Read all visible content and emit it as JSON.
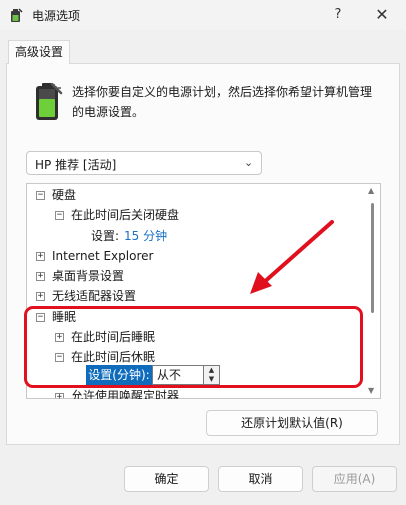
{
  "window": {
    "title": "电源选项",
    "help_glyph": "?",
    "close_glyph": "✕",
    "icon": "power-options-icon"
  },
  "tab": {
    "label": "高级设置"
  },
  "description": "选择你要自定义的电源计划，然后选择你希望计算机管理的电源设置。",
  "plan_select": {
    "value": "HP 推荐 [活动]"
  },
  "tree": {
    "items": {
      "hard_disk": {
        "toggle": "−",
        "label": "硬盘"
      },
      "hard_disk_off": {
        "toggle": "−",
        "label": "在此时间后关闭硬盘"
      },
      "hard_disk_setting": {
        "label": "设置:",
        "value": "15 分钟"
      },
      "ie": {
        "toggle": "+",
        "label": "Internet Explorer"
      },
      "desktop_bg": {
        "toggle": "+",
        "label": "桌面背景设置"
      },
      "wireless": {
        "toggle": "+",
        "label": "无线适配器设置"
      },
      "sleep": {
        "toggle": "−",
        "label": "睡眠"
      },
      "sleep_after": {
        "toggle": "+",
        "label": "在此时间后睡眠"
      },
      "hibernate_after": {
        "toggle": "−",
        "label": "在此时间后休眠"
      },
      "hibernate_setting": {
        "label": "设置(分钟):",
        "value": "从不"
      },
      "wake_timers": {
        "toggle": "+",
        "label": "允许使用唤醒定时器"
      }
    }
  },
  "buttons": {
    "restore": "还原计划默认值(R)",
    "ok": "确定",
    "cancel": "取消",
    "apply": "应用(A)"
  },
  "colors": {
    "annotation_red": "#e0101e",
    "selection_blue": "#0f6cbd",
    "value_blue": "#1a6fc4"
  }
}
